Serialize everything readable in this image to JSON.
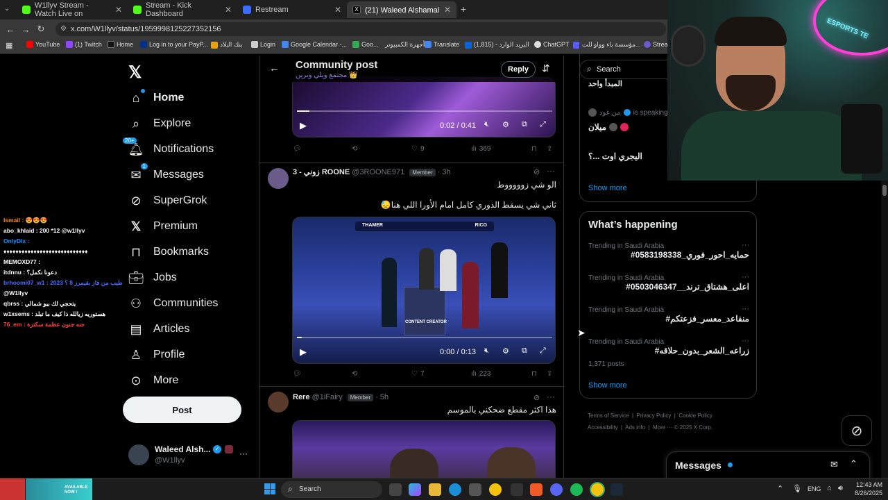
{
  "browser": {
    "tabs": [
      {
        "title": "W1llyv Stream - Watch Live on",
        "color": "#53fc18"
      },
      {
        "title": "Stream - Kick Dashboard",
        "color": "#53fc18"
      },
      {
        "title": "Restream",
        "color": "#3b6cff"
      },
      {
        "title": "(21) Waleed Alshamali 🌸 on X",
        "color": "#111111"
      }
    ],
    "url": "x.com/W1llyv/status/1959998125227352156",
    "bookmarks": [
      "YouTube",
      "(1) Twitch",
      "Home",
      "Log in to your PayP...",
      "بنك البلاد",
      "Login",
      "Google Calendar -...",
      "Goo...",
      "أجهزة الكمبيوتر",
      "Translate",
      "البريد الوارد - (1,815)",
      "ChatGPT",
      "مؤسسة باء وواو للت...",
      "Strea"
    ]
  },
  "chat": [
    {
      "text": "Ismail : 😍😍😍",
      "color": "#ff8c00"
    },
    {
      "text": "abo_khlaid : 200 *12 @w1llyv",
      "color": "#ffffff"
    },
    {
      "text": "OnlyDlx :",
      "color": "#1e90ff"
    },
    {
      "text": "♦♦♦♦♦♦♦♦♦♦♦♦♦♦♦♦♦♦♦♦♦♦♦♦♦♦♦♦",
      "color": "#ffffff"
    },
    {
      "text": "MEMOXD77 :",
      "color": "#ffffff"
    },
    {
      "text": "itdnnu : دعونا نكمل؟",
      "color": "#ffffff"
    },
    {
      "text": "brhoomi07_w1 : 2023 طيب من فاز بقيمرز 8 ؟",
      "color": "#4a6cff"
    },
    {
      "text": "@W1llyv",
      "color": "#ffffff"
    },
    {
      "text": "qbrss : يتحجي لك بيو شمالي",
      "color": "#ffffff"
    },
    {
      "text": "w1xsems : هستوريه زيالله ذا كيف ما تبلد",
      "color": "#ffffff"
    },
    {
      "text": "76_em : جنه جنون عظمة سكترة",
      "color": "#ff4040"
    }
  ],
  "nav": {
    "items": [
      "Home",
      "Explore",
      "Notifications",
      "Messages",
      "SuperGrok",
      "Premium",
      "Bookmarks",
      "Jobs",
      "Communities",
      "Articles",
      "Profile",
      "More"
    ],
    "notifications_badge": "20+",
    "messages_badge": "1",
    "post_label": "Post",
    "account_name": "Waleed Alsh...",
    "account_handle": "@W1llyv"
  },
  "header": {
    "title": "Community post",
    "community": "مجتمع ويلي وبرين 👑",
    "reply_label": "Reply"
  },
  "post0": {
    "video_time": "0:02 / 0:41",
    "progress": 0.05,
    "stats": {
      "replies": "",
      "reposts": "",
      "likes": "9",
      "views": "369"
    }
  },
  "post1": {
    "name": "3 - زوني ROONE",
    "handle": "@3ROONE971",
    "badge": "Member",
    "time": "3h",
    "line1": "الو شي زوووووط",
    "line2": "ثاني شي يسقط الدوري كامل امام الأورا اللي هنا😓",
    "video_time": "0:00 / 0:13",
    "banner_left": "THAMER",
    "banner_right": "RICO",
    "stand_text": "CONTENT CREATOR",
    "progress": 0.02,
    "stats": {
      "likes": "7",
      "views": "223"
    }
  },
  "post2": {
    "name": "Rere",
    "handle": "@1iFairy",
    "badge": "Member",
    "time": "5h",
    "line1": "هذا اكثر مقطع ضحكني بالموسم"
  },
  "right": {
    "search_placeholder": "Search",
    "space": {
      "top_text": "المبدأ واحد",
      "speaker": "من غود",
      "speaking": "is speaking",
      "topic": "ميلان",
      "question": "اليجري اوت ...؟",
      "show_more": "Show more"
    },
    "happening_title": "What’s happening",
    "trends": [
      {
        "meta": "Trending in Saudi Arabia",
        "title": "#حمايه_احور_فوري_0583198338",
        "posts": ""
      },
      {
        "meta": "Trending in Saudi Arabia",
        "title": "#اعلى_هشتاق_ترند__0503046347",
        "posts": ""
      },
      {
        "meta": "Trending in Saudi Arabia",
        "title": "#منفاعد_معسر_فزعتكم",
        "posts": ""
      },
      {
        "meta": "Trending in Saudi Arabia",
        "title": "#زراعه_الشعر_بدون_حلاقه",
        "posts": "1,371 posts"
      }
    ],
    "show_more": "Show more",
    "footer": [
      "Terms of Service",
      "Privacy Policy",
      "Cookie Policy",
      "Accessibility",
      "Ads info",
      "More ···",
      "© 2025 X Corp."
    ]
  },
  "messages_drawer": {
    "label": "Messages"
  },
  "webcam": {
    "neon_text": "ESPORTS TE"
  },
  "taskbar": {
    "search": "Search",
    "lang": "ENG",
    "time": "12:43 AM",
    "date": "8/26/2025",
    "promo": "AVAILABLE NOW !"
  }
}
